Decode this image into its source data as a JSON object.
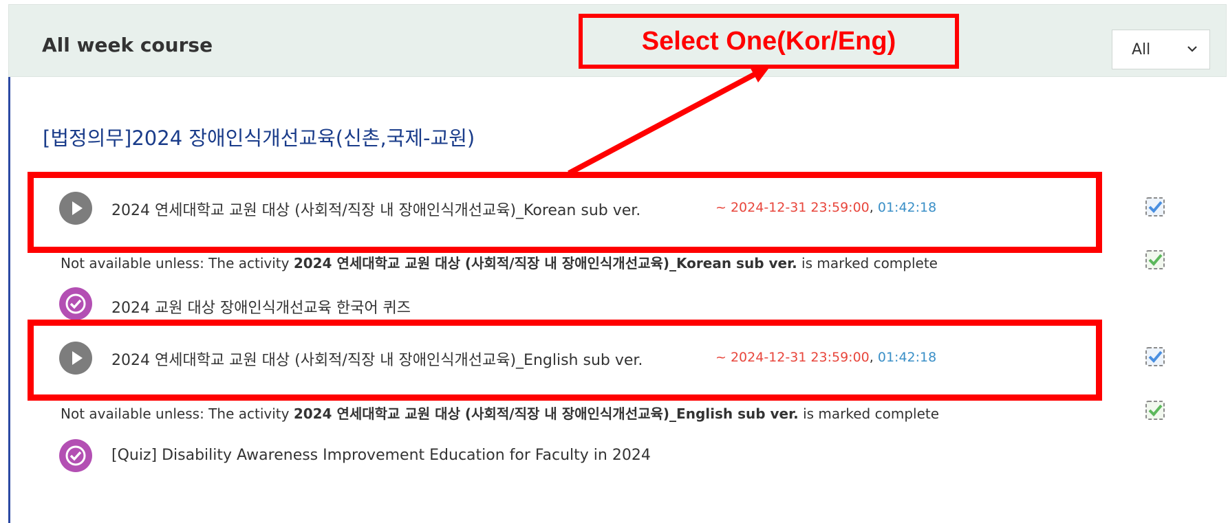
{
  "header": {
    "title": "All week course",
    "filter_value": "All"
  },
  "section": {
    "title": "[법정의무]2024 장애인식개선교육(신촌,국제-교원)"
  },
  "items": [
    {
      "type": "video",
      "icon": "play-icon",
      "title": "2024 연세대학교 교원 대상 (사회적/직장 내 장애인식개선교육)_Korean sub ver.",
      "deadline": "~ 2024-12-31 23:59:00",
      "duration": "01:42:18",
      "completion": "manual-check"
    },
    {
      "type": "quiz",
      "icon": "quiz-check-icon",
      "restriction_prefix": "Not available unless: The activity ",
      "restriction_activity": "2024 연세대학교 교원 대상 (사회적/직장 내 장애인식개선교육)_Korean sub ver.",
      "restriction_suffix": " is marked complete",
      "title": "2024 교원 대상 장애인식개선교육 한국어 퀴즈",
      "completion": "auto-check"
    },
    {
      "type": "video",
      "icon": "play-icon",
      "title": "2024 연세대학교 교원 대상 (사회적/직장 내 장애인식개선교육)_English sub ver.",
      "deadline": "~ 2024-12-31 23:59:00",
      "duration": "01:42:18",
      "completion": "manual-check"
    },
    {
      "type": "quiz",
      "icon": "quiz-check-icon",
      "restriction_prefix": "Not available unless: The activity ",
      "restriction_activity": "2024 연세대학교 교원 대상 (사회적/직장 내 장애인식개선교육)_English sub ver.",
      "restriction_suffix": " is marked complete",
      "title": "[Quiz] Disability Awareness Improvement Education for Faculty in 2024",
      "completion": "auto-check"
    }
  ],
  "annotation": {
    "callout_text": "Select One(Kor/Eng)",
    "color": "#ff0000"
  },
  "colors": {
    "header_bg": "#e8f0ec",
    "section_title": "#1a3c8a",
    "deadline": "#e8463c",
    "duration": "#3a8fc7",
    "play_icon": "#7d7d7d",
    "quiz_icon": "#b34fb3",
    "check_blue": "#4a8fe0",
    "check_green": "#5cb85c"
  }
}
